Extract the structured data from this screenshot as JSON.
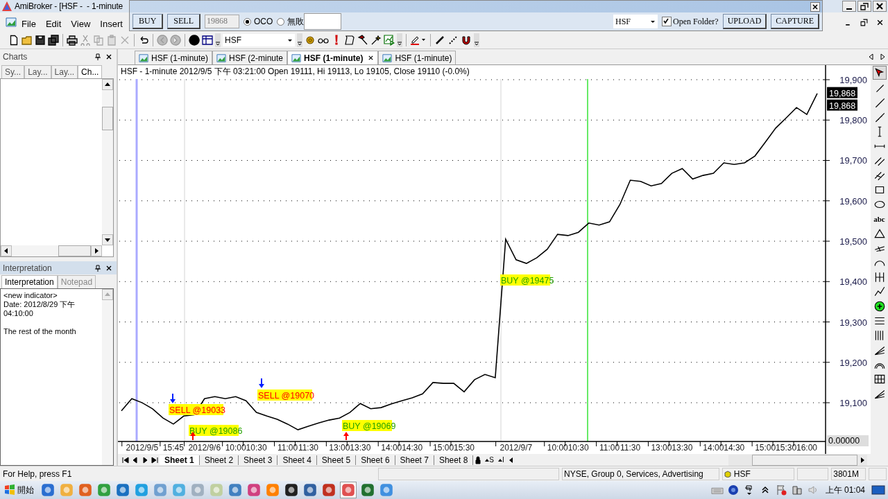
{
  "window": {
    "title": "AmiBroker - [HSF -  - 1-minute"
  },
  "order_panel": {
    "buttons": [
      "BUY",
      "SELL"
    ],
    "price": "19868",
    "radios": [
      {
        "label": "OCO",
        "selected": true
      },
      {
        "label": "無敗",
        "selected": false
      }
    ],
    "symbol": "HSF",
    "open_folder": {
      "label": "Open Folder?",
      "checked": true
    },
    "actions": [
      "UPLOAD",
      "CAPTURE"
    ]
  },
  "menu": [
    "File",
    "Edit",
    "View",
    "Insert"
  ],
  "toolbar": {
    "symbol": "HSF"
  },
  "charts_panel": {
    "title": "Charts",
    "tabs": [
      {
        "label": "Sy...",
        "selected": false
      },
      {
        "label": "Lay...",
        "selected": false
      },
      {
        "label": "Lay...",
        "selected": false
      },
      {
        "label": "Ch...",
        "selected": true
      }
    ]
  },
  "interpretation_panel": {
    "title": "Interpretation",
    "tabs": [
      {
        "label": "Interpretation",
        "selected": true
      },
      {
        "label": "Notepad",
        "selected": false
      }
    ],
    "heading": "<new indicator>",
    "date": "Date: 2012/8/29 下午 04:10:00",
    "text": "The rest of the month"
  },
  "doc_tabs": [
    {
      "label": "HSF (1-minute)",
      "selected": false
    },
    {
      "label": "HSF (2-minute",
      "selected": false
    },
    {
      "label": "HSF (1-minute)",
      "selected": true
    },
    {
      "label": "HSF (1-minute)",
      "selected": false
    }
  ],
  "chart": {
    "chart_data": {
      "type": "line",
      "title": "HSF - 1-minute 2012/9/5 下午 03:21:00 Open 19111, Hi 19113, Lo 19105, Close 19110 (-0.0%)",
      "categories": [
        null,
        null,
        "2012/9/5",
        null,
        null,
        "15:45",
        null,
        null,
        "2012/9/6",
        null,
        null,
        "10:00",
        null,
        "10:30",
        null,
        null,
        "11:00",
        null,
        "11:30",
        null,
        null,
        "13:00",
        null,
        "13:30",
        null,
        null,
        "14:00",
        null,
        "14:30",
        null,
        null,
        "15:00",
        null,
        "15:30",
        null,
        null,
        null,
        null,
        "2012/9/7",
        null,
        null,
        null,
        "10:00",
        null,
        "10:30",
        null,
        null,
        "11:00",
        null,
        "11:30",
        null,
        null,
        "13:00",
        null,
        "13:30",
        null,
        null,
        "14:00",
        null,
        "14:30",
        null,
        null,
        "15:00",
        null,
        "15:30",
        null,
        "16:00",
        null
      ],
      "series": [
        {
          "color": "#000000",
          "values": [
            19080,
            19110,
            19100,
            19085,
            19062,
            19047,
            19067,
            19070,
            19110,
            19115,
            19110,
            19115,
            19105,
            19076,
            19067,
            19059,
            19047,
            19033,
            19042,
            19050,
            19057,
            19062,
            19076,
            19098,
            19085,
            19088,
            19097,
            19105,
            19112,
            19122,
            19150,
            19148,
            19148,
            19127,
            19157,
            19170,
            19162,
            19505,
            19454,
            19445,
            19459,
            19480,
            19517,
            19514,
            19522,
            19545,
            19540,
            19548,
            19591,
            19651,
            19648,
            19637,
            19643,
            19668,
            19680,
            19654,
            19663,
            19668,
            19694,
            19690,
            19694,
            19711,
            19745,
            19780,
            19805,
            19831,
            19814,
            19866
          ]
        }
      ],
      "ylim": [
        19004,
        19936
      ],
      "grid": true,
      "yticks": [
        {
          "value": 19100,
          "label": "19,100"
        },
        {
          "value": 19200,
          "label": "19,200"
        },
        {
          "value": 19300,
          "label": "19,300"
        },
        {
          "value": 19400,
          "label": "19,400"
        },
        {
          "value": 19500,
          "label": "19,500"
        },
        {
          "value": 19600,
          "label": "19,600"
        },
        {
          "value": 19700,
          "label": "19,700"
        },
        {
          "value": 19800,
          "label": "19,800"
        },
        {
          "value": 19900,
          "label": "19,900"
        }
      ]
    },
    "signals": [
      {
        "text": "SELL @19033",
        "kind": "sell"
      },
      {
        "text": "BUY @19086",
        "kind": "buy"
      },
      {
        "text": "SELL @19070",
        "kind": "sell"
      },
      {
        "text": "BUY @19069",
        "kind": "buy"
      },
      {
        "text": "BUY @19475",
        "kind": "buy"
      }
    ],
    "markers": [
      {
        "kind": "sell"
      },
      {
        "kind": "buy"
      },
      {
        "kind": "sell"
      },
      {
        "kind": "buy"
      }
    ],
    "vlines": [
      {
        "kind": "selection"
      },
      {
        "kind": "separator"
      },
      {
        "kind": "separator"
      },
      {
        "kind": "cursor"
      }
    ],
    "price_labels": [
      "19,868",
      "19,868"
    ],
    "indicator_value": "0.00000"
  },
  "drawing_toolbar": {
    "text_tool": "abc"
  },
  "sheet_tabs": [
    {
      "label": "Sheet 1",
      "selected": true
    },
    {
      "label": "Sheet 2",
      "selected": false
    },
    {
      "label": "Sheet 3",
      "selected": false
    },
    {
      "label": "Sheet 4",
      "selected": false
    },
    {
      "label": "Sheet 5",
      "selected": false
    },
    {
      "label": "Sheet 6",
      "selected": false
    },
    {
      "label": "Sheet 7",
      "selected": false
    },
    {
      "label": "Sheet 8",
      "selected": false
    }
  ],
  "sheet_controls": [
    "S",
    "I"
  ],
  "status_bar": {
    "help": "For Help, press F1",
    "info": "NYSE, Group 0, Services, Advertising",
    "symbol": "HSF",
    "memory": "3801M"
  },
  "taskbar": {
    "start": "開始",
    "clock": "上午 01:04"
  }
}
